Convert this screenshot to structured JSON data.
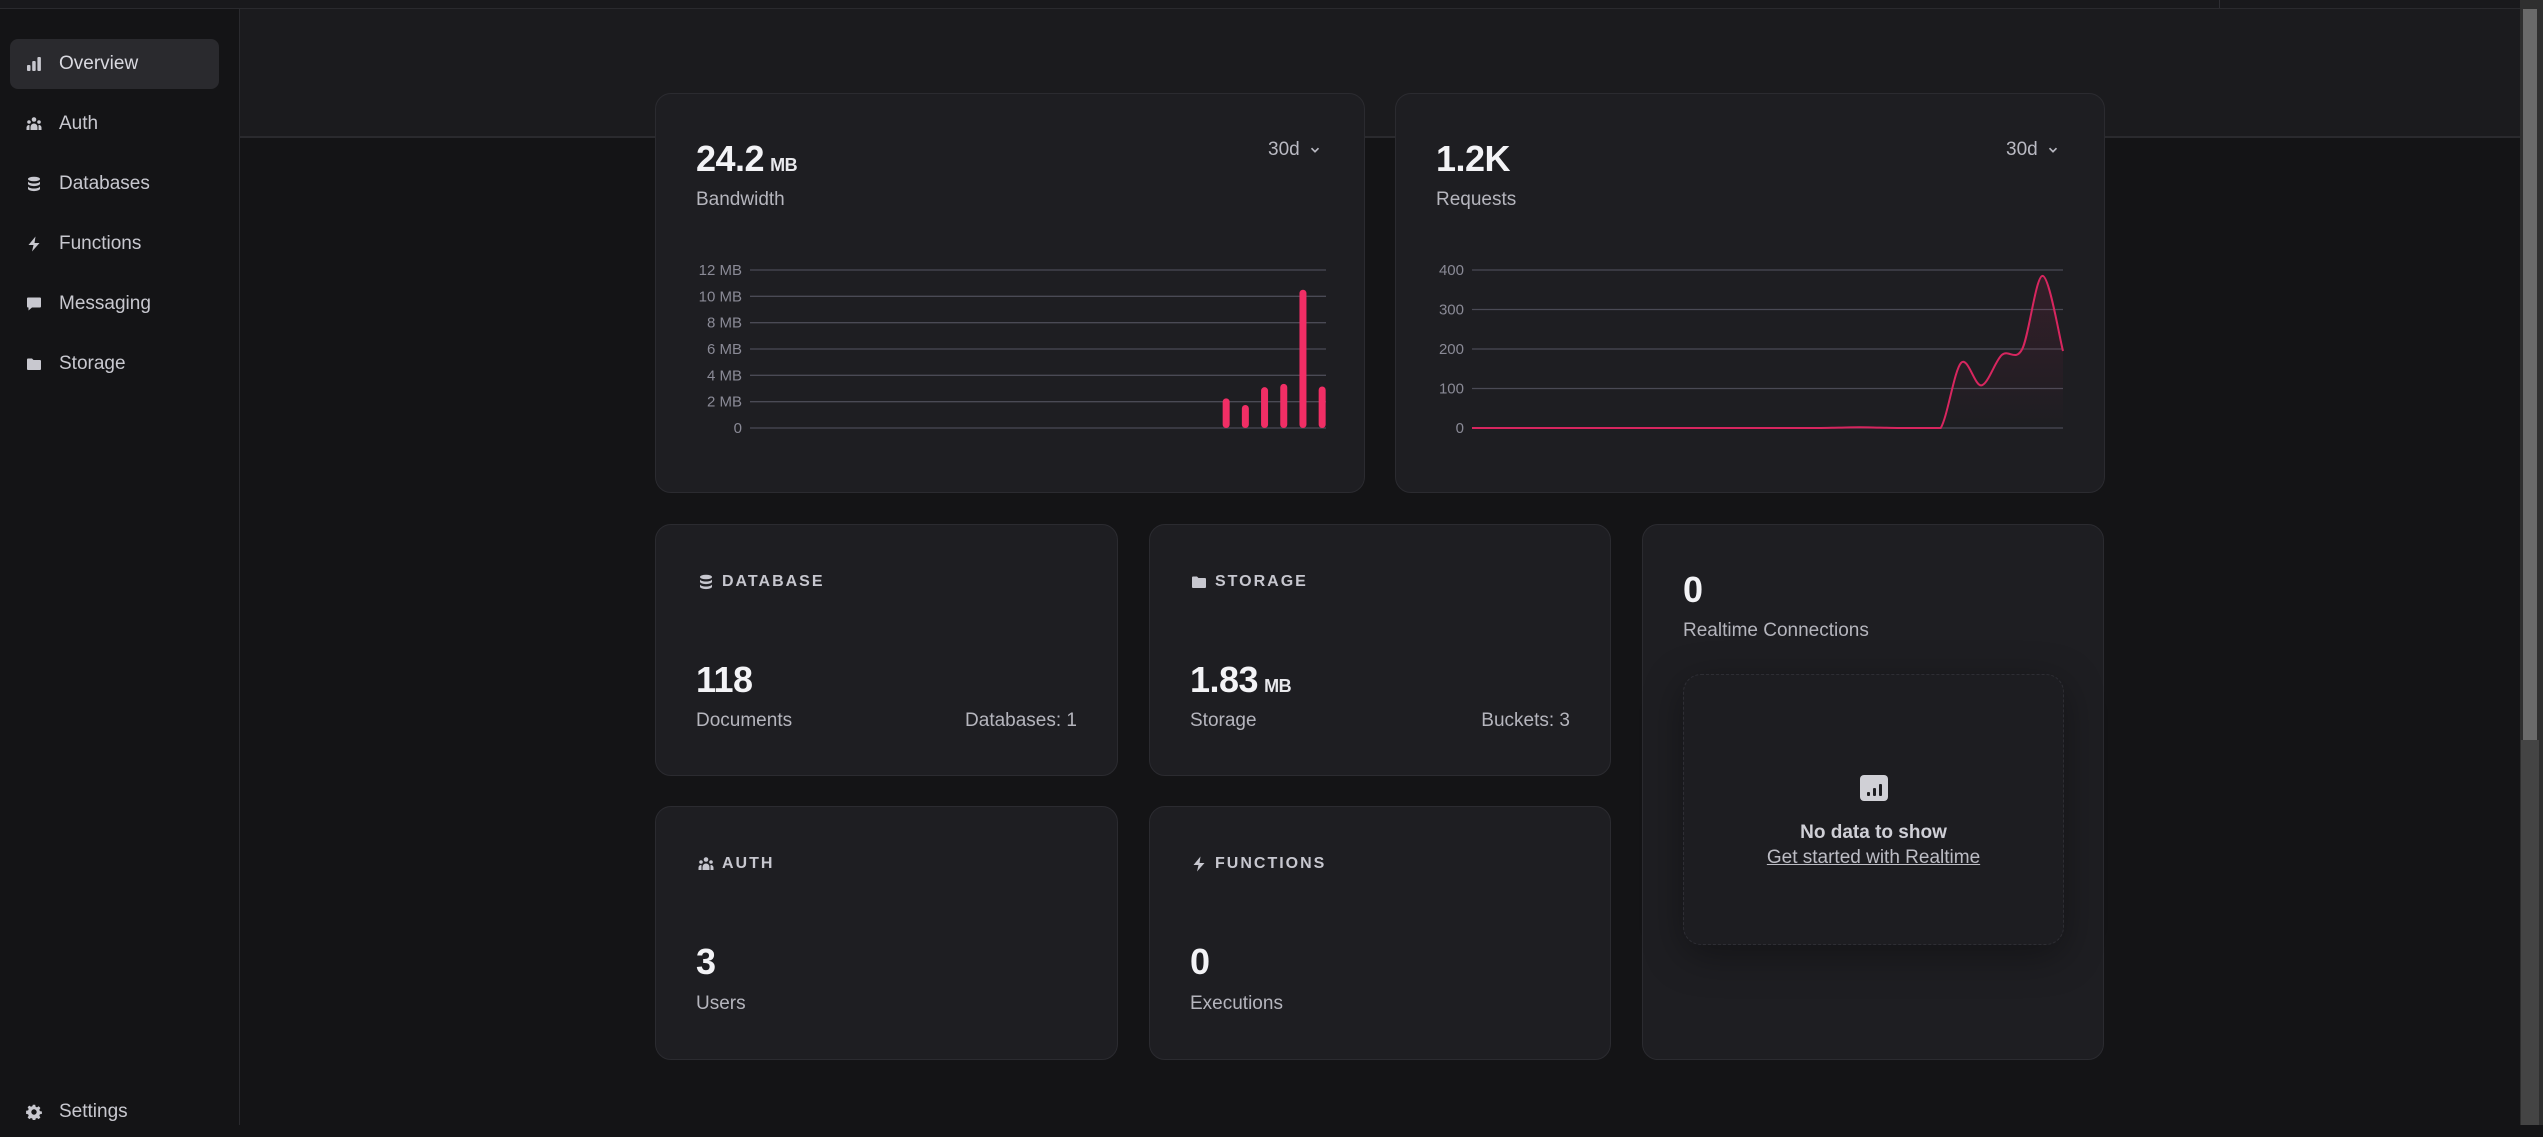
{
  "sidebar": {
    "items": [
      {
        "label": "Overview",
        "icon": "chart-bar-icon",
        "active": true
      },
      {
        "label": "Auth",
        "icon": "users-icon",
        "active": false
      },
      {
        "label": "Databases",
        "icon": "database-icon",
        "active": false
      },
      {
        "label": "Functions",
        "icon": "lightning-icon",
        "active": false
      },
      {
        "label": "Messaging",
        "icon": "chat-bubble-icon",
        "active": false
      },
      {
        "label": "Storage",
        "icon": "folder-icon",
        "active": false
      }
    ],
    "settings": {
      "label": "Settings",
      "icon": "gear-icon"
    }
  },
  "bandwidth": {
    "value": "24.2",
    "unit": "MB",
    "label": "Bandwidth",
    "range": "30d"
  },
  "requests": {
    "value": "1.2K",
    "label": "Requests",
    "range": "30d"
  },
  "database": {
    "heading": "DATABASE",
    "value": "118",
    "label": "Documents",
    "side": "Databases: 1"
  },
  "storage": {
    "heading": "STORAGE",
    "value": "1.83",
    "unit": "MB",
    "label": "Storage",
    "side": "Buckets: 3"
  },
  "auth": {
    "heading": "AUTH",
    "value": "3",
    "label": "Users"
  },
  "functions": {
    "heading": "FUNCTIONS",
    "value": "0",
    "label": "Executions"
  },
  "realtime": {
    "value": "0",
    "label": "Realtime Connections",
    "empty_title": "No data to show",
    "empty_link": "Get started with Realtime"
  },
  "colors": {
    "accent": "#f02e65",
    "line": "#d7265f",
    "grid": "#4a4a55"
  },
  "chart_data": [
    {
      "type": "bar",
      "title": "Bandwidth",
      "ylabel": "",
      "xlabel": "",
      "ylim": [
        0,
        12
      ],
      "y_ticks": [
        "0",
        "2 MB",
        "4 MB",
        "6 MB",
        "8 MB",
        "10 MB",
        "12 MB"
      ],
      "y_tick_values": [
        0,
        2,
        4,
        6,
        8,
        10,
        12
      ],
      "x_days": 30,
      "grid": true,
      "series": [
        {
          "name": "Bandwidth (MB)",
          "days": [
            24,
            25,
            26,
            27,
            28,
            29
          ],
          "values": [
            2.25,
            1.75,
            3.1,
            3.35,
            10.5,
            3.15
          ]
        }
      ]
    },
    {
      "type": "line",
      "title": "Requests",
      "ylabel": "",
      "xlabel": "",
      "ylim": [
        0,
        400
      ],
      "y_ticks": [
        "0",
        "100",
        "200",
        "300",
        "400"
      ],
      "y_tick_values": [
        0,
        100,
        200,
        300,
        400
      ],
      "x_days": 30,
      "grid": true,
      "series": [
        {
          "name": "Requests",
          "values": [
            0,
            0,
            0,
            0,
            0,
            0,
            0,
            0,
            0,
            0,
            0,
            0,
            0,
            0,
            0,
            0,
            0,
            0,
            1,
            2,
            1,
            0,
            0,
            0,
            165,
            108,
            185,
            200,
            385,
            195
          ]
        }
      ]
    }
  ]
}
